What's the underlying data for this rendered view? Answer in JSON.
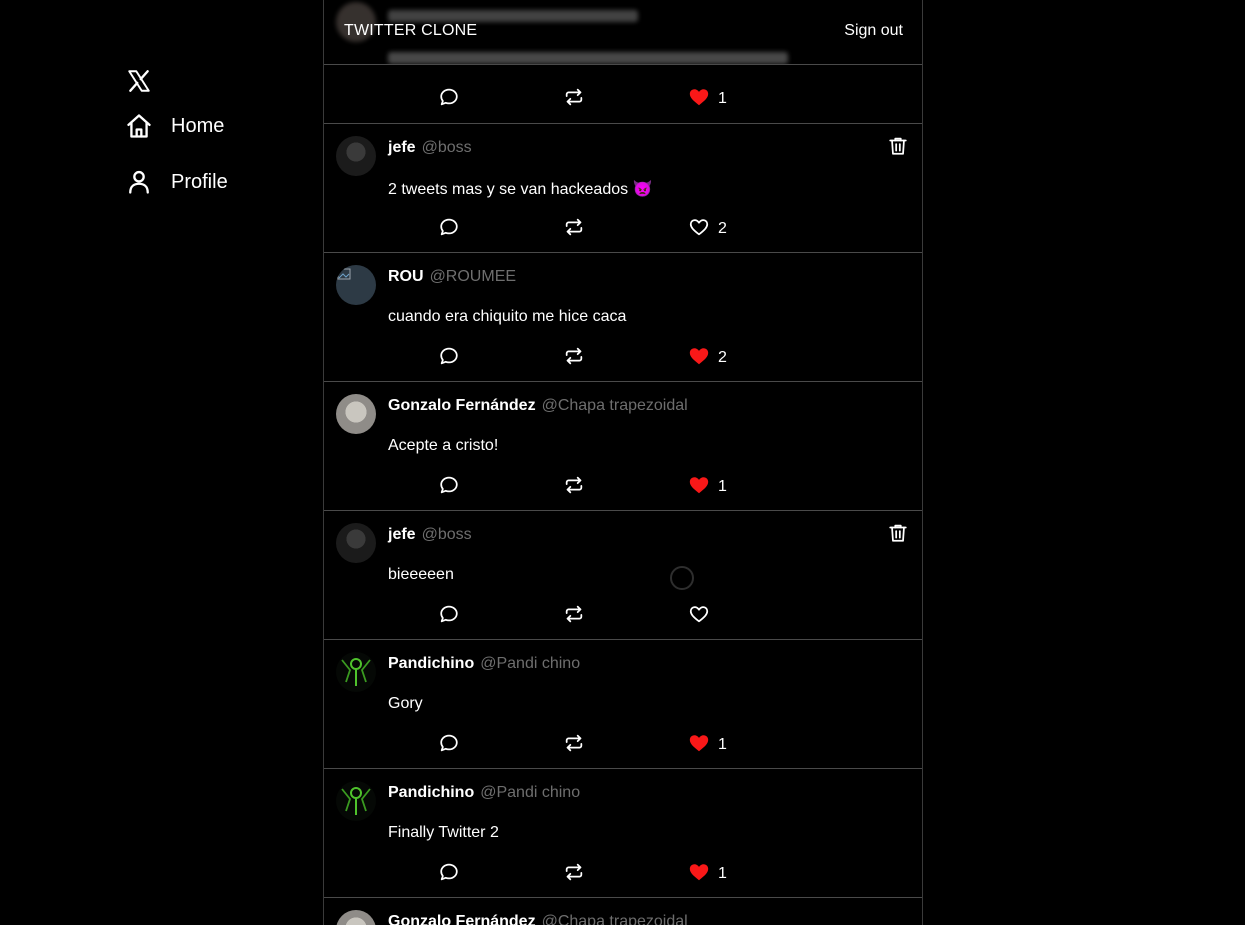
{
  "header": {
    "title": "TWITTER CLONE",
    "sign_out_label": "Sign out"
  },
  "sidebar": {
    "logo_icon": "x-logo-icon",
    "items": [
      {
        "label": "Home",
        "icon": "home-icon"
      },
      {
        "label": "Profile",
        "icon": "user-icon"
      }
    ]
  },
  "colors": {
    "background": "#000000",
    "text": "#ffffff",
    "handle": "#6e6e6e",
    "like_active": "#f91818",
    "divider": "#4a4a4a"
  },
  "partial_top_tweet": {
    "like_count": "1",
    "liked": true
  },
  "tweets": [
    {
      "author": "jefe",
      "handle": "@boss",
      "text": "2 tweets mas y se van hackeados 👿",
      "like_count": "2",
      "liked": false,
      "deletable": true
    },
    {
      "author": "ROU",
      "handle": "@ROUMEE",
      "text": "cuando era chiquito me hice caca",
      "like_count": "2",
      "liked": true,
      "deletable": false
    },
    {
      "author": "Gonzalo Fernández",
      "handle": "@Chapa trapezoidal",
      "text": "Acepte a cristo!",
      "like_count": "1",
      "liked": true,
      "deletable": false
    },
    {
      "author": "jefe",
      "handle": "@boss",
      "text": "bieeeeen",
      "like_count": "",
      "liked": false,
      "deletable": true,
      "loading": true
    },
    {
      "author": "Pandichino",
      "handle": "@Pandi chino",
      "text": "Gory",
      "like_count": "1",
      "liked": true,
      "deletable": false
    },
    {
      "author": "Pandichino",
      "handle": "@Pandi chino",
      "text": "Finally Twitter 2",
      "like_count": "1",
      "liked": true,
      "deletable": false
    }
  ],
  "partial_bottom_tweet": {
    "author": "Gonzalo Fernández",
    "handle": "@Chapa trapezoidal"
  }
}
